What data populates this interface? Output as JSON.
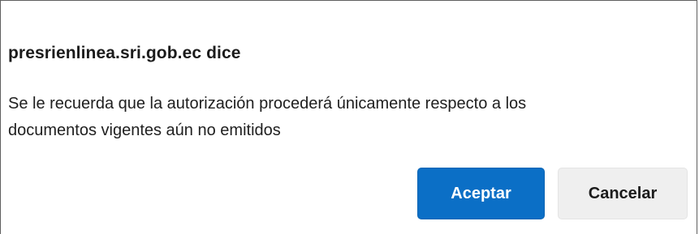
{
  "dialog": {
    "title": "presrienlinea.sri.gob.ec dice",
    "message_line1": "Se le recuerda que la autorización procederá únicamente respecto a los",
    "message_line2": "documentos vigentes aún no emitidos",
    "buttons": {
      "accept_label": "Aceptar",
      "cancel_label": "Cancelar"
    },
    "colors": {
      "accent": "#0b6fc6",
      "secondary_button": "#efefef"
    }
  }
}
